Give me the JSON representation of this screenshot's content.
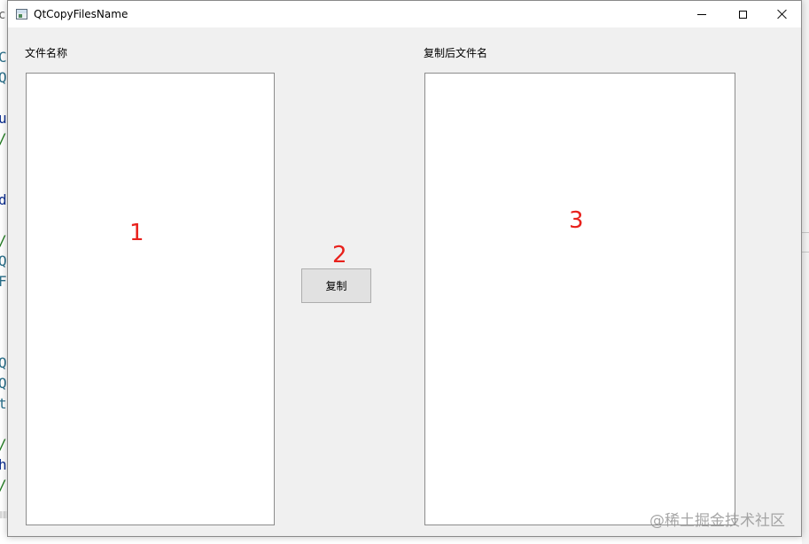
{
  "window": {
    "title": "QtCopyFilesName"
  },
  "form": {
    "source_label": "文件名称",
    "dest_label": "复制后文件名",
    "copy_button_label": "复制"
  },
  "annotations": {
    "marker_1": "1",
    "marker_2": "2",
    "marker_3": "3"
  },
  "background_editor": {
    "fragments": [
      "c",
      "Co",
      "Q",
      "ui",
      "/",
      "d",
      "/",
      "Q",
      "F",
      "Q",
      "Q",
      "t",
      "/",
      "h",
      "/"
    ]
  },
  "watermark": "@稀土掘金技术社区",
  "colors": {
    "annotation": "#e8211c",
    "window_bg": "#f0f0f0",
    "list_bg": "#ffffff",
    "button_bg": "#e1e1e1"
  }
}
